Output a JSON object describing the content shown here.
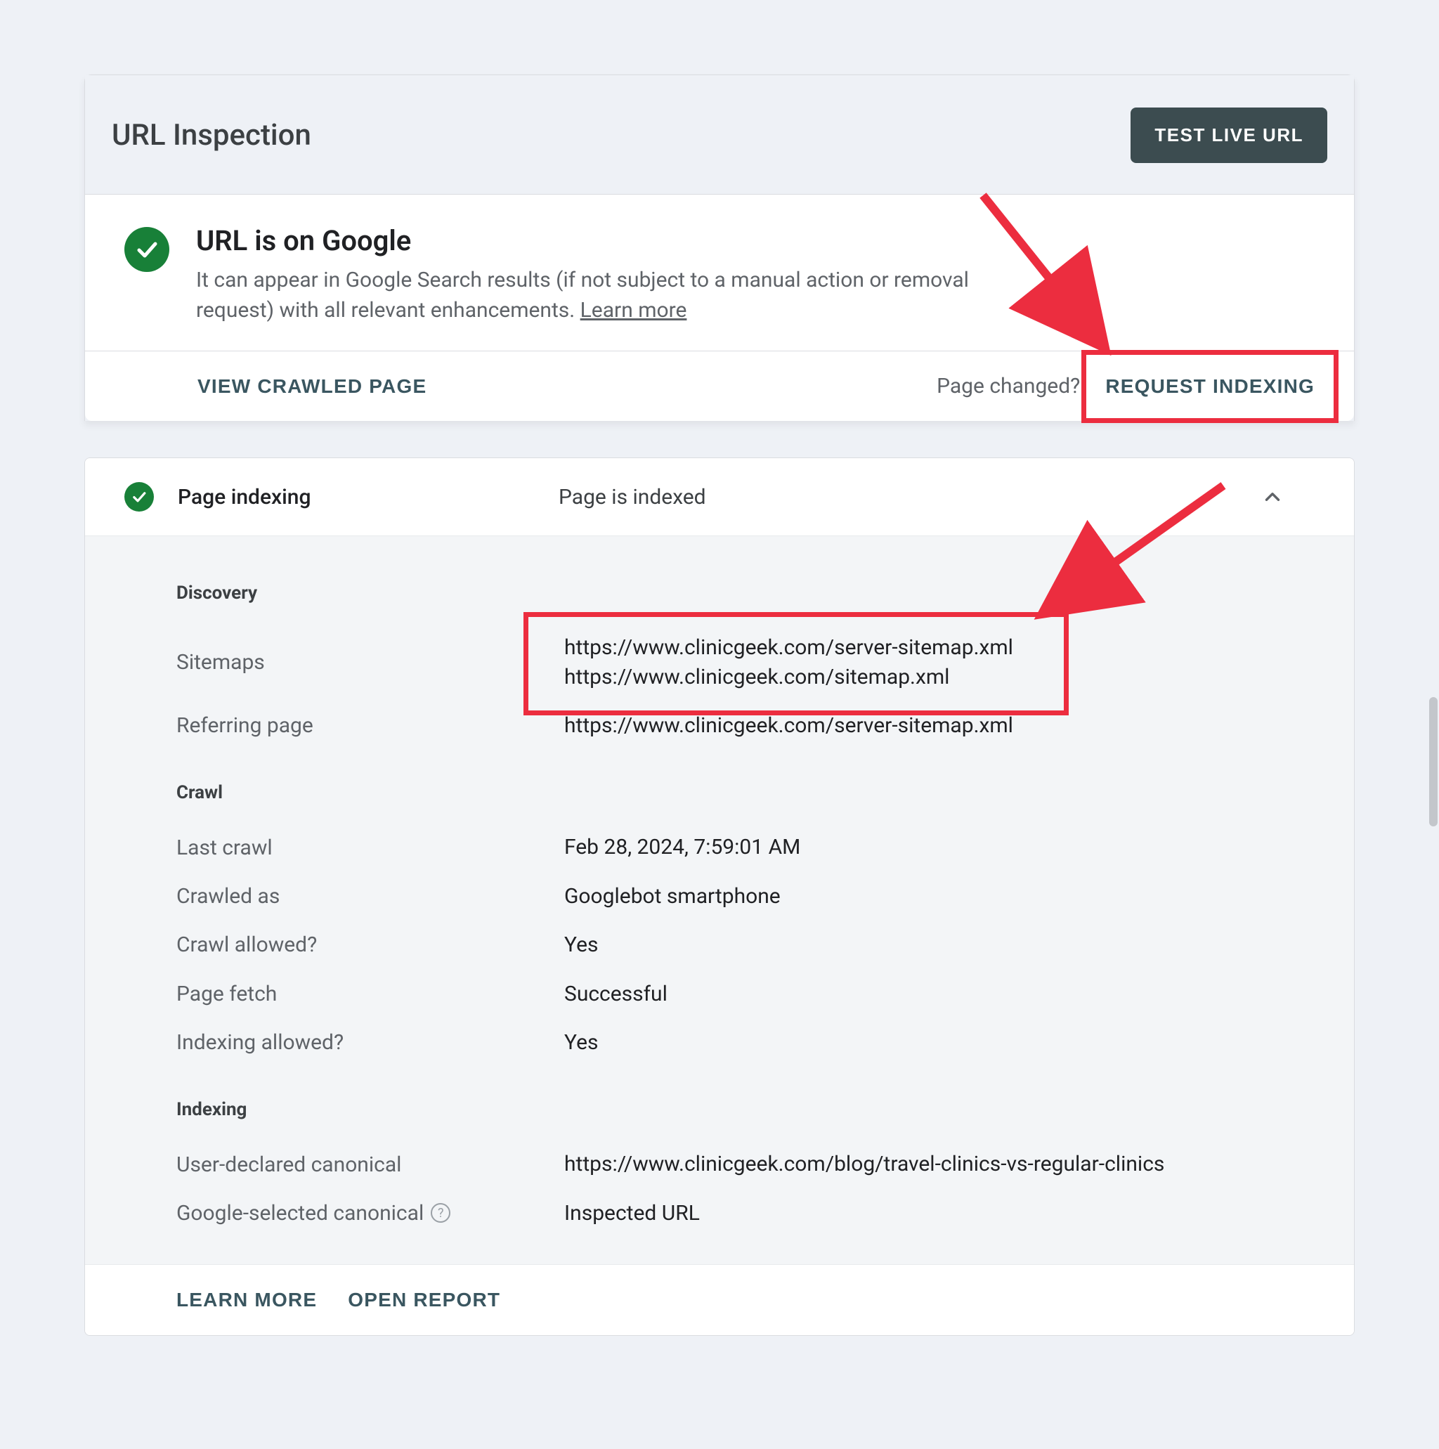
{
  "header": {
    "title": "URL Inspection",
    "test_live_url_label": "TEST LIVE URL"
  },
  "status": {
    "title": "URL is on Google",
    "subtitle_a": "It can appear in Google Search results (if not subject to a manual action or removal request) with all relevant enhancements. ",
    "learn_more": "Learn more"
  },
  "actions": {
    "view_crawled_label": "VIEW CRAWLED PAGE",
    "page_changed_label": "Page changed?",
    "request_indexing_label": "REQUEST INDEXING"
  },
  "indexing_panel": {
    "title": "Page indexing",
    "status": "Page is indexed",
    "sections": {
      "discovery": {
        "heading": "Discovery",
        "sitemaps_label": "Sitemaps",
        "sitemaps_value_1": "https://www.clinicgeek.com/server-sitemap.xml",
        "sitemaps_value_2": "https://www.clinicgeek.com/sitemap.xml",
        "referring_label": "Referring page",
        "referring_value": "https://www.clinicgeek.com/server-sitemap.xml"
      },
      "crawl": {
        "heading": "Crawl",
        "last_crawl_label": "Last crawl",
        "last_crawl_value": "Feb 28, 2024, 7:59:01 AM",
        "crawled_as_label": "Crawled as",
        "crawled_as_value": "Googlebot smartphone",
        "crawl_allowed_label": "Crawl allowed?",
        "crawl_allowed_value": "Yes",
        "page_fetch_label": "Page fetch",
        "page_fetch_value": "Successful",
        "indexing_allowed_label": "Indexing allowed?",
        "indexing_allowed_value": "Yes"
      },
      "indexing": {
        "heading": "Indexing",
        "user_canonical_label": "User-declared canonical",
        "user_canonical_value": "https://www.clinicgeek.com/blog/travel-clinics-vs-regular-clinics",
        "google_canonical_label": "Google-selected canonical",
        "google_canonical_value": "Inspected URL"
      }
    },
    "footer": {
      "learn_more": "LEARN MORE",
      "open_report": "OPEN REPORT"
    }
  },
  "annotations": {
    "box1_target": "request-indexing",
    "box2_target": "sitemaps-values"
  }
}
